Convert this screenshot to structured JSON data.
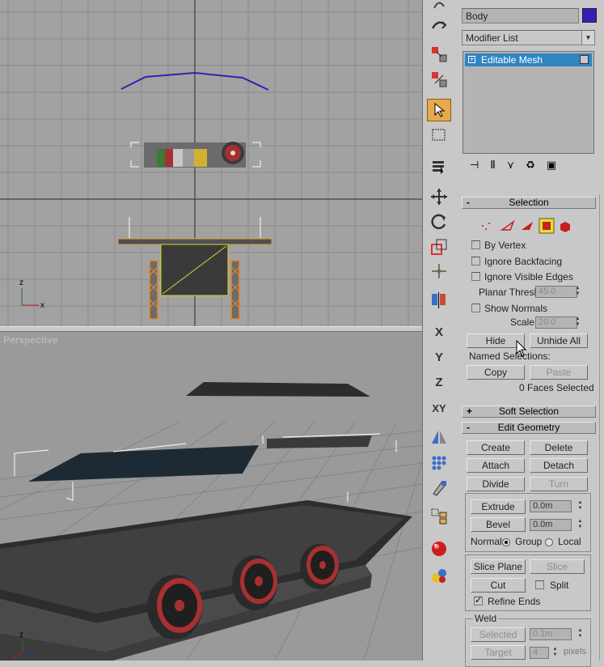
{
  "viewports": {
    "top": {
      "label": ""
    },
    "perspective": {
      "label": "Perspective"
    }
  },
  "toolbar": {
    "axis_x": "X",
    "axis_y": "Y",
    "axis_z": "Z",
    "axis_xy": "XY"
  },
  "panel": {
    "object_name": "Body",
    "object_color": "#3c1bb5",
    "modifier_list": "Modifier List",
    "stack_item": "Editable Mesh",
    "selection": {
      "title": "Selection",
      "by_vertex": "By Vertex",
      "ignore_backfacing": "Ignore Backfacing",
      "ignore_visible_edges": "Ignore Visible Edges",
      "planar_thresh_label": "Planar Thresh:",
      "planar_thresh_value": "45.0",
      "show_normals": "Show Normals",
      "scale_label": "Scale:",
      "scale_value": "20.0",
      "hide": "Hide",
      "unhide_all": "Unhide All",
      "named_selections": "Named Selections:",
      "copy": "Copy",
      "paste": "Paste",
      "status": "0 Faces Selected"
    },
    "soft_selection": {
      "title": "Soft Selection"
    },
    "edit_geometry": {
      "title": "Edit Geometry",
      "create": "Create",
      "delete": "Delete",
      "attach": "Attach",
      "detach": "Detach",
      "divide": "Divide",
      "turn": "Turn",
      "extrude": "Extrude",
      "extrude_value": "0.0m",
      "bevel": "Bevel",
      "bevel_value": "0.0m",
      "normal_label": "Normal:",
      "group": "Group",
      "local": "Local",
      "slice_plane": "Slice Plane",
      "slice": "Slice",
      "cut": "Cut",
      "split": "Split",
      "refine_ends": "Refine Ends",
      "weld_title": "Weld",
      "selected": "Selected",
      "selected_value": "0.1m",
      "target": "Target",
      "target_value": "4",
      "pixels": "pixels"
    }
  }
}
